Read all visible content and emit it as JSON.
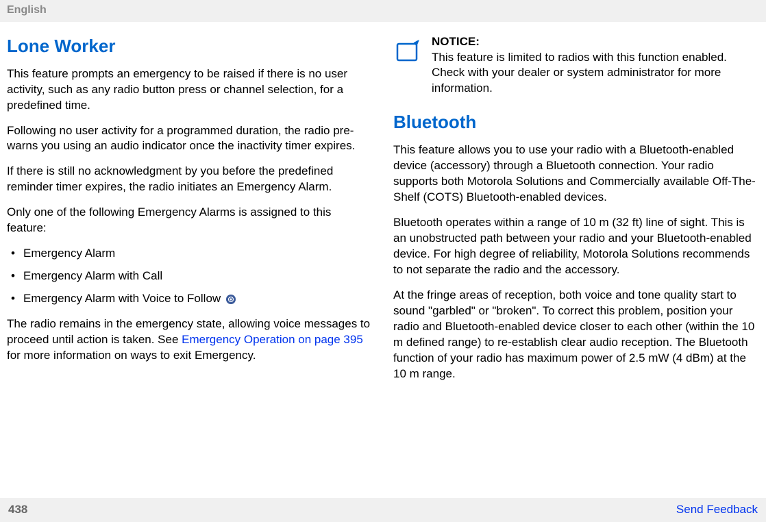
{
  "header": {
    "language": "English"
  },
  "left": {
    "heading": "Lone Worker",
    "p1": "This feature prompts an emergency to be raised if there is no user activity, such as any radio button press or channel selection, for a predefined time.",
    "p2": "Following no user activity for a programmed duration, the radio pre-warns you using an audio indicator once the inactivity timer expires.",
    "p3": "If there is still no acknowledgment by you before the predefined reminder timer expires, the radio initiates an Emergency Alarm.",
    "p4": "Only one of the following Emergency Alarms is assigned to this feature:",
    "bullets": [
      "Emergency Alarm",
      "Emergency Alarm with Call",
      "Emergency Alarm with Voice to Follow"
    ],
    "p5_before": "The radio remains in the emergency state, allowing voice messages to proceed until action is taken. See ",
    "p5_link": "Emergency Operation on page 395",
    "p5_after": " for more information on ways to exit Emergency."
  },
  "right": {
    "notice_label": "NOTICE:",
    "notice_text": "This feature is limited to radios with this function enabled. Check with your dealer or system administrator for more information.",
    "heading": "Bluetooth",
    "p1": "This feature allows you to use your radio with a Bluetooth-enabled device (accessory) through a Bluetooth connection. Your radio supports both Motorola Solutions and Commercially available Off-The-Shelf (COTS) Bluetooth-enabled devices.",
    "p2": "Bluetooth operates within a range of 10 m (32 ft) line of sight. This is an unobstructed path between your radio and your Bluetooth-enabled device. For high degree of reliability, Motorola Solutions recommends to not separate the radio and the accessory.",
    "p3": "At the fringe areas of reception, both voice and tone quality start to sound \"garbled\" or \"broken\". To correct this problem, position your radio and Bluetooth-enabled device closer to each other (within the 10 m defined range) to re-establish clear audio reception. The Bluetooth function of your radio has maximum power of 2.5 mW (4 dBm) at the 10 m range."
  },
  "footer": {
    "page": "438",
    "feedback": "Send Feedback"
  }
}
